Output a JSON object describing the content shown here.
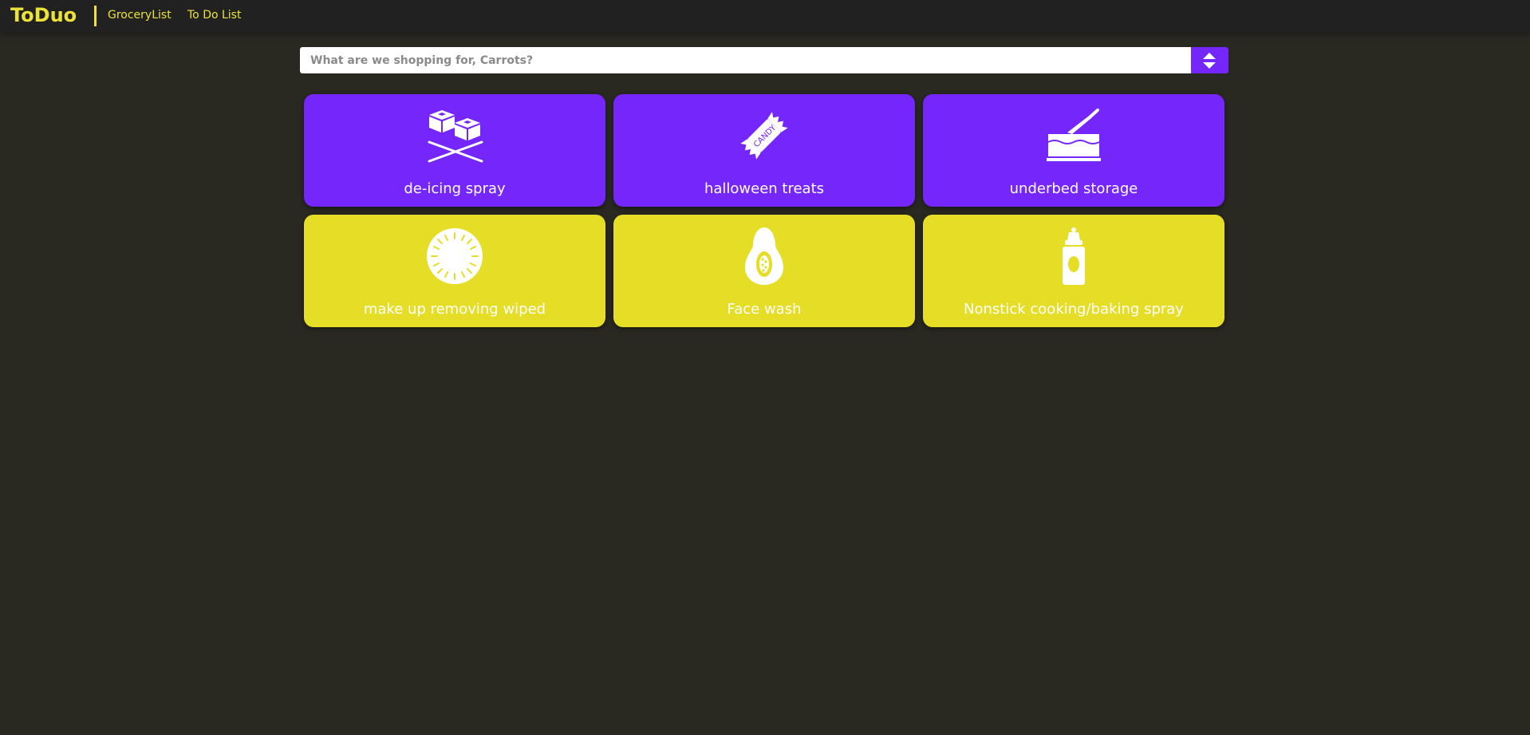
{
  "app": {
    "brand": "ToDuo",
    "nav": {
      "grocery_label": "GroceryList",
      "todo_label": "To Do List"
    }
  },
  "search": {
    "placeholder": "What are we shopping for, Carrots?",
    "value": ""
  },
  "colors": {
    "accent_purple": "#7426fb",
    "accent_yellow": "#e6dd26",
    "background": "#292821",
    "navbar": "#212121"
  },
  "items": [
    {
      "label": "de-icing spray",
      "icon": "ice-cubes-icon",
      "color": "purple"
    },
    {
      "label": "halloween treats",
      "icon": "candy-icon",
      "color": "purple"
    },
    {
      "label": "underbed storage",
      "icon": "cake-knife-icon",
      "color": "purple"
    },
    {
      "label": "make up removing wiped",
      "icon": "melon-slice-icon",
      "color": "yellow"
    },
    {
      "label": "Face wash",
      "icon": "papaya-icon",
      "color": "yellow"
    },
    {
      "label": "Nonstick cooking/baking spray",
      "icon": "baby-bottle-icon",
      "color": "yellow"
    }
  ]
}
